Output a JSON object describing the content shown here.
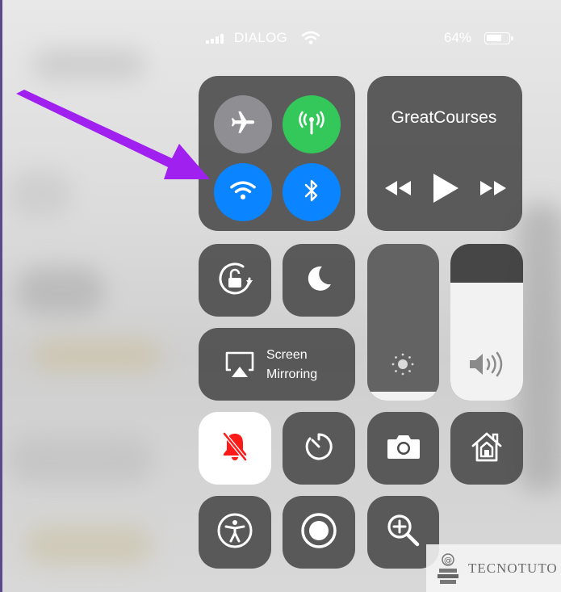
{
  "status_bar": {
    "carrier": "DIALOG",
    "battery_percent": "64%",
    "signal_bars": 4,
    "battery_level": 0.64
  },
  "connectivity": {
    "airplane": {
      "icon": "airplane-icon",
      "state": "off",
      "color": "#8e8e93"
    },
    "cellular": {
      "icon": "cellular-antenna-icon",
      "state": "on",
      "color": "#34c759"
    },
    "wifi": {
      "icon": "wifi-icon",
      "state": "on",
      "color": "#0a84ff"
    },
    "bluetooth": {
      "icon": "bluetooth-icon",
      "state": "on",
      "color": "#0a84ff"
    }
  },
  "now_playing": {
    "title": "GreatCourses",
    "controls": [
      "rewind-icon",
      "play-icon",
      "fast-forward-icon"
    ]
  },
  "toggles": {
    "rotation_lock": {
      "icon": "rotation-lock-icon"
    },
    "do_not_disturb": {
      "icon": "moon-icon"
    },
    "screen_mirroring": {
      "line1": "Screen",
      "line2": "Mirroring",
      "icon": "airplay-icon"
    }
  },
  "sliders": {
    "brightness": {
      "icon": "sun-icon",
      "level": 0.06
    },
    "volume": {
      "icon": "speaker-icon",
      "level": 0.72
    }
  },
  "shortcuts": [
    {
      "name": "silent-mode",
      "icon": "bell-slash-icon",
      "color": "#ff1a1a"
    },
    {
      "name": "timer",
      "icon": "timer-icon"
    },
    {
      "name": "camera",
      "icon": "camera-icon"
    },
    {
      "name": "home",
      "icon": "home-icon"
    },
    {
      "name": "accessibility",
      "icon": "accessibility-icon"
    },
    {
      "name": "screen-recording",
      "icon": "record-icon"
    },
    {
      "name": "magnifier",
      "icon": "magnifier-icon"
    }
  ],
  "annotation": {
    "arrow_color": "#a020f0"
  },
  "watermark": {
    "text": "TECNOTUTO"
  },
  "colors": {
    "tile": "#484848",
    "green": "#34c759",
    "blue": "#0a84ff",
    "accent_arrow": "#a020f0"
  }
}
